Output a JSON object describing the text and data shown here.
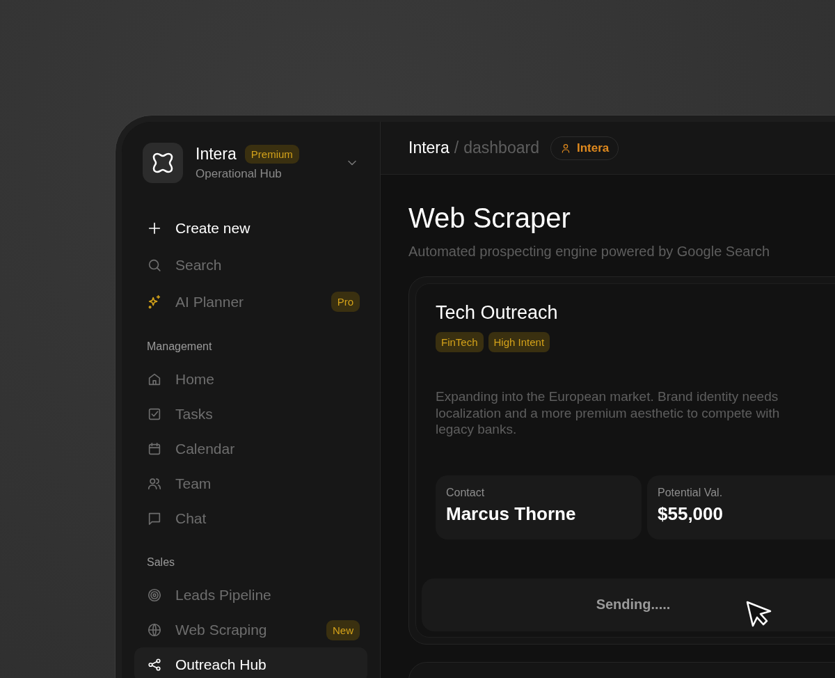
{
  "brand": {
    "name": "Intera",
    "badge": "Premium",
    "subtitle": "Operational Hub"
  },
  "sidebar": {
    "actions": [
      {
        "kind": "create",
        "label": "Create new"
      },
      {
        "kind": "search",
        "label": "Search"
      },
      {
        "kind": "planner",
        "label": "AI Planner",
        "badge": "Pro"
      }
    ],
    "sections": [
      {
        "title": "Management",
        "items": [
          {
            "label": "Home",
            "selected": false
          },
          {
            "label": "Tasks",
            "selected": false
          },
          {
            "label": "Calendar",
            "selected": false
          },
          {
            "label": "Team",
            "selected": false
          },
          {
            "label": "Chat",
            "selected": false
          }
        ]
      },
      {
        "title": "Sales",
        "items": [
          {
            "label": "Leads Pipeline",
            "selected": false
          },
          {
            "label": "Web Scraping",
            "badge": "New",
            "selected": false
          },
          {
            "label": "Outreach Hub",
            "selected": true
          }
        ]
      }
    ]
  },
  "header": {
    "breadcrumb": [
      "Intera",
      "dashboard"
    ],
    "separator": "/",
    "workspace": "Intera"
  },
  "page": {
    "title": "Web Scraper",
    "subtitle": "Automated prospecting engine powered by Google Search"
  },
  "cards": [
    {
      "title": "Tech Outreach",
      "tags": [
        "FinTech",
        "High Intent"
      ],
      "description": "Expanding into the European market. Brand identity needs localization and a more premium aesthetic to compete with legacy banks.",
      "fields": [
        {
          "label": "Contact",
          "value": "Marcus Thorne"
        },
        {
          "label": "Potential Val.",
          "value": "$55,000"
        }
      ],
      "button": "Sending....."
    }
  ]
}
